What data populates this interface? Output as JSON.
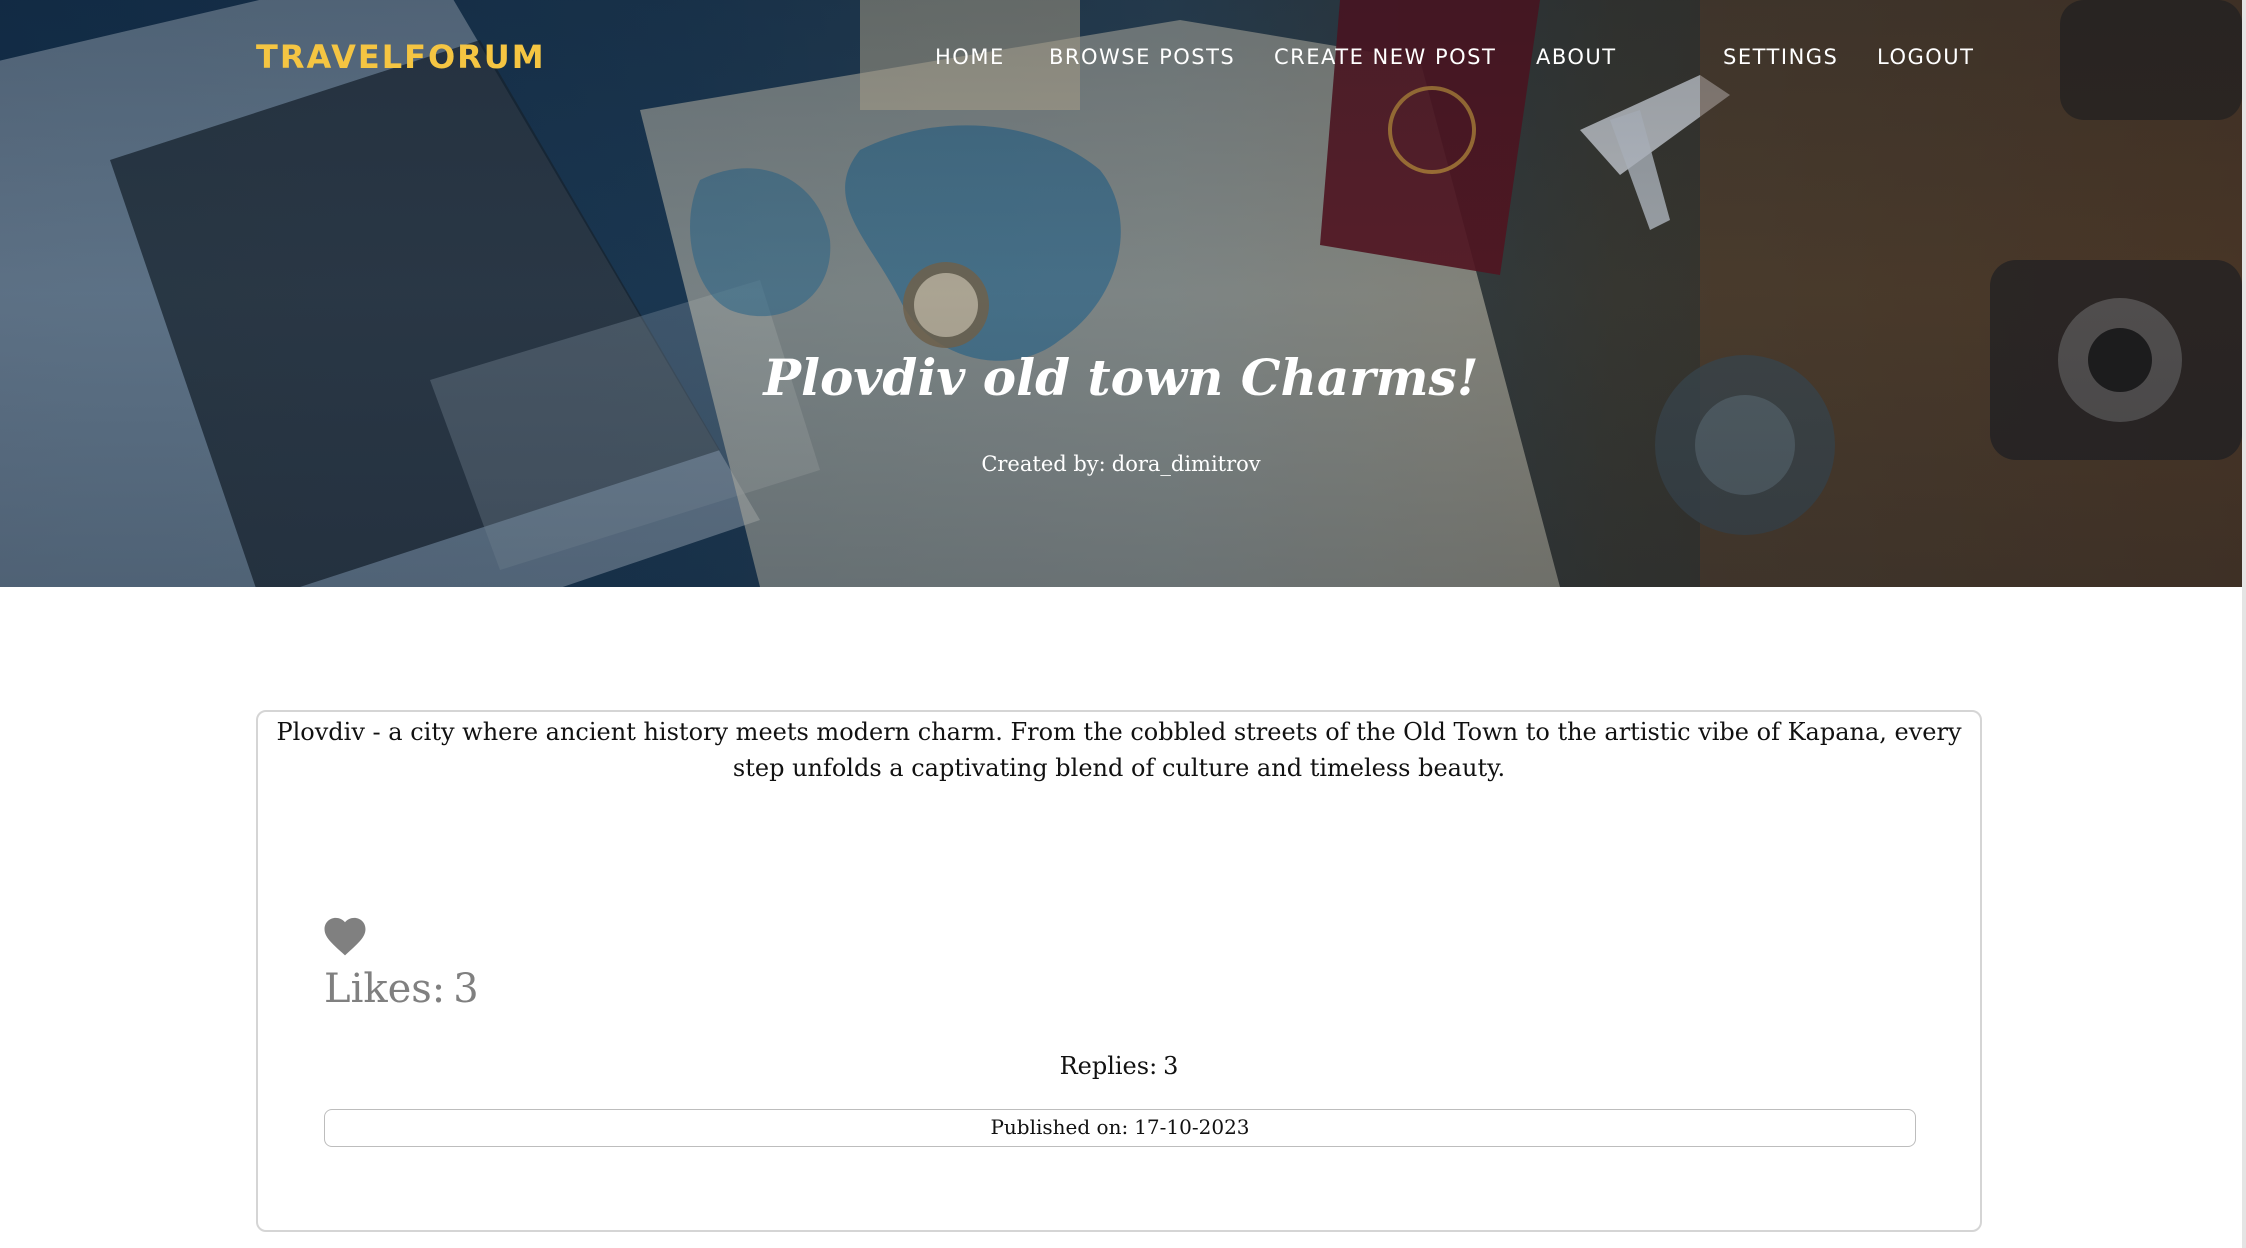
{
  "nav": {
    "brand": "TRAVELFORUM",
    "home": "HOME",
    "browse_posts": "BROWSE POSTS",
    "create_new_post": "CREATE NEW POST",
    "about": "ABOUT",
    "settings": "SETTINGS",
    "logout": "LOGOUT"
  },
  "post": {
    "title": "Plovdiv old town Charms!",
    "author_prefix": "Created by:",
    "author": "dora_dimitrov",
    "body": "Plovdiv - a city where ancient history meets modern charm. From the cobbled streets of the Old Town to the artistic vibe of Kapana, every step unfolds a captivating blend of culture and timeless beauty.",
    "likes_label": "Likes:",
    "likes_count": "3",
    "replies_label": "Replies:",
    "replies_count": "3",
    "published_label": "Published on:",
    "published_date": "17-10-2023"
  },
  "colors": {
    "brand": "#f5c542",
    "nav_text": "#ffffff",
    "likes": "#808080",
    "card_border": "#d5d5d5"
  },
  "icons": {
    "like": "heart-icon"
  }
}
